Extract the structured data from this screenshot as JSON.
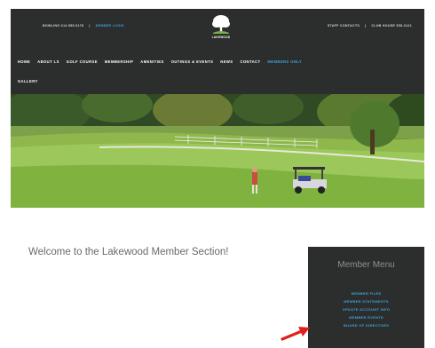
{
  "header": {
    "top_left": {
      "phone": "BOWLING 614.555.0178",
      "email": "MEMBER LOGIN"
    },
    "top_right": {
      "link1": "STAFF CONTACTS",
      "link2": "CLUB HOUSE 555-0121"
    },
    "logo_text": "LAKEWOOD"
  },
  "nav": {
    "items": [
      "HOME",
      "ABOUT LS",
      "GOLF COURSE",
      "MEMBERSHIP",
      "AMENITIES",
      "OUTINGS & EVENTS",
      "NEWS",
      "CONTACT",
      "MEMBERS ONLY"
    ],
    "row2": [
      "GALLERY"
    ]
  },
  "hero": {
    "alt": "golf-course-photo"
  },
  "main": {
    "welcome": "Welcome to the Lakewood Member Section!"
  },
  "member_menu": {
    "title": "Member Menu",
    "items": [
      "MEMBER FILES",
      "MEMBER STATEMENTS",
      "UPDATE ACCOUNT INFO",
      "MEMBER EVENTS",
      "BOARD OF DIRECTORS"
    ]
  },
  "colors": {
    "header_bg": "#2c2d2d",
    "accent": "#3fa3d8",
    "arrow": "#e0201c"
  }
}
